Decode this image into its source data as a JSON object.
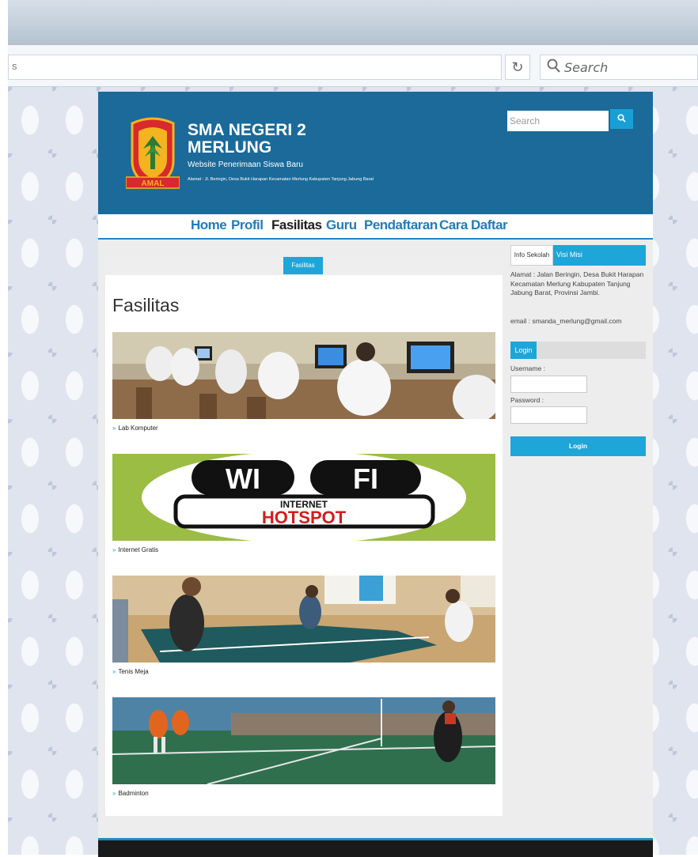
{
  "browser": {
    "url_fragment": "s",
    "search_placeholder": "Search"
  },
  "site": {
    "title": "SMA NEGERI 2 MERLUNG",
    "subtitle": "Website Penerimaan Siswa Baru",
    "address_line": "Alamat : Jl. Beringin, Desa Bukit Harapan Kecamatan Merlung Kabupaten Tanjung Jabung Barat",
    "logo_text": "AMAL",
    "search_placeholder": "Search"
  },
  "nav": {
    "items": [
      "Home",
      "Profil",
      "Fasilitas",
      "Guru",
      "Pendaftaran",
      "Cara Daftar"
    ],
    "active": "Fasilitas"
  },
  "main": {
    "tab_label": "Fasilitas",
    "heading": "Fasilitas",
    "facilities": [
      {
        "caption": "Lab Komputer",
        "image": "computer-lab-photo"
      },
      {
        "caption": "Internet Gratis",
        "image": "wifi-hotspot-banner"
      },
      {
        "caption": "Tenis Meja",
        "image": "table-tennis-photo"
      },
      {
        "caption": "Badminton",
        "image": "badminton-photo"
      }
    ],
    "wifi_banner": {
      "wi": "WI",
      "fi": "FI",
      "internet": "INTERNET",
      "hotspot": "HOTSPOT"
    }
  },
  "sidebar": {
    "tab_info": "Info Sekolah",
    "tab_visi": "Visi  Misi",
    "info_text": "Alamat : Jalan Beringin, Desa Bukit Harapan Kecamatan Merlung Kabupaten Tanjung Jabung Barat, Provinsi Jambi.",
    "email_text": "email : smanda_merlung@gmail.com",
    "login": {
      "heading": "Login",
      "username_label": "Username :",
      "password_label": "Password :",
      "button_label": "Login"
    }
  },
  "colors": {
    "header_blue": "#1b6a99",
    "accent_blue": "#1ea6d8",
    "nav_text": "#1f7db8"
  }
}
